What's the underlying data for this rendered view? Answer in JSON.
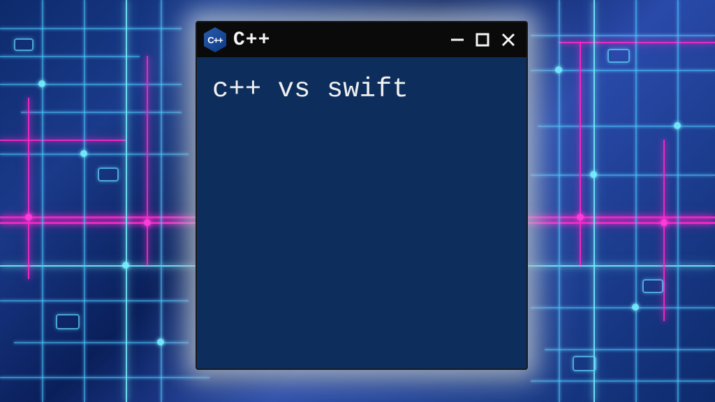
{
  "window": {
    "title": "C++",
    "logo_text": "C++",
    "body_text": "c++ vs swift"
  },
  "controls": {
    "minimize": "minimize",
    "maximize": "maximize",
    "close": "close"
  }
}
